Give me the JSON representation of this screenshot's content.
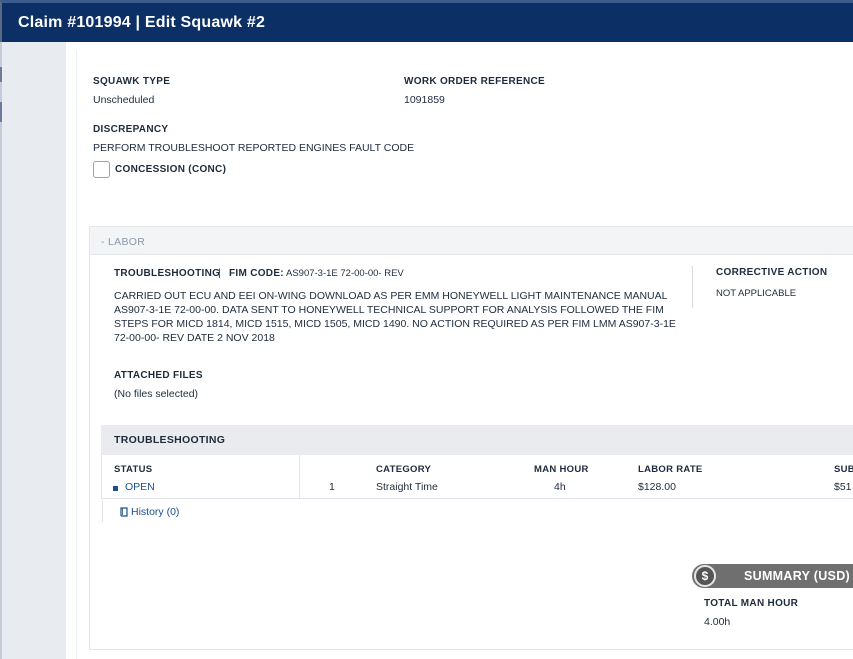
{
  "header": {
    "title": "Claim #101994 | Edit Squawk #2"
  },
  "squawk": {
    "type_label": "SQUAWK TYPE",
    "type_value": "Unscheduled",
    "wo_label": "WORK ORDER REFERENCE",
    "wo_value": "1091859",
    "discrepancy_label": "DISCREPANCY",
    "discrepancy_value": "PERFORM TROUBLESHOOT REPORTED ENGINES FAULT CODE",
    "concession_label": "CONCESSION (CONC)",
    "concession_checked": false
  },
  "labor": {
    "section_toggle": "- LABOR",
    "type_label": "TROUBLESHOOTING",
    "separator": "|",
    "fim_label": "FIM CODE:",
    "fim_value": "AS907-3-1E 72-00-00- REV",
    "description": "CARRIED OUT ECU AND EEI ON-WING DOWNLOAD AS PER EMM HONEYWELL LIGHT MAINTENANCE MANUAL AS907-3-1E 72-00-00. DATA SENT TO HONEYWELL TECHNICAL SUPPORT FOR ANALYSIS FOLLOWED THE FIM STEPS FOR MICD 1814, MICD 1515, MICD 1505, MICD 1490. NO ACTION REQUIRED AS PER FIM LMM AS907-3-1E 72-00-00- REV DATE 2 NOV 2018",
    "corrective_label": "CORRECTIVE ACTION",
    "corrective_value": "NOT APPLICABLE",
    "attached_label": "ATTACHED FILES",
    "attached_value": "(No files selected)"
  },
  "troubleshooting_table": {
    "title": "TROUBLESHOOTING",
    "headers": {
      "status": "STATUS",
      "category": "CATEGORY",
      "man_hour": "MAN HOUR",
      "labor_rate": "LABOR RATE",
      "subtotal": "SUB"
    },
    "row": {
      "status": "OPEN",
      "index": "1",
      "category": "Straight Time",
      "man_hour": "4h",
      "labor_rate": "$128.00",
      "subtotal": "$51"
    },
    "history_link": "History (0)"
  },
  "summary": {
    "coin": "$",
    "title": "SUMMARY (USD)",
    "total_label": "TOTAL MAN HOUR",
    "total_value": "4.00h"
  },
  "colors": {
    "header_bg": "#0c3065",
    "link": "#1a4f8f",
    "summary_pill": "#6f6f6f"
  },
  "icons": {
    "history": "book-icon",
    "status": "status-dot-icon",
    "summary": "dollar-coin-icon"
  }
}
